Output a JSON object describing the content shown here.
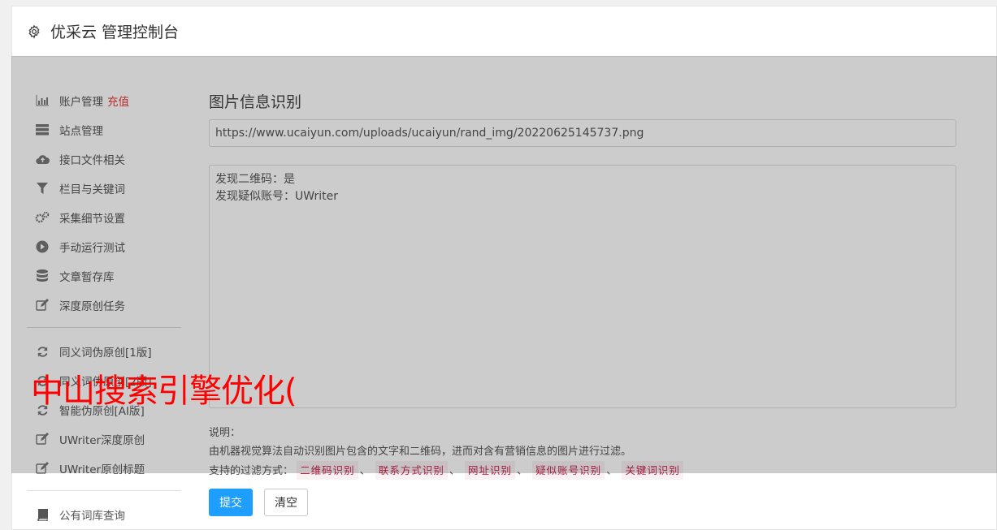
{
  "header": {
    "title": "优采云 管理控制台",
    "icon": "gear-icon"
  },
  "sidebar": {
    "items": [
      {
        "label": "账户管理",
        "badge": "充值",
        "icon": "bar-chart-icon"
      },
      {
        "label": "站点管理",
        "icon": "server-icon"
      },
      {
        "label": "接口文件相关",
        "icon": "cloud-upload-icon"
      },
      {
        "label": "栏目与关键词",
        "icon": "filter-icon"
      },
      {
        "label": "采集细节设置",
        "icon": "gears-icon"
      },
      {
        "label": "手动运行测试",
        "icon": "play-circle-icon"
      },
      {
        "label": "文章暂存库",
        "icon": "database-icon"
      },
      {
        "label": "深度原创任务",
        "icon": "edit-icon"
      },
      {
        "label": "同义词伪原创[1版]",
        "icon": "refresh-icon"
      },
      {
        "label": "同义词伪原创[2版]",
        "icon": "refresh-icon"
      },
      {
        "label": "智能伪原创[AI版]",
        "icon": "refresh-icon"
      },
      {
        "label": "UWriter深度原创",
        "icon": "edit-icon"
      },
      {
        "label": "UWriter原创标题",
        "icon": "edit-icon"
      },
      {
        "label": "公有词库查询",
        "icon": "book-icon"
      }
    ]
  },
  "main": {
    "title": "图片信息识别",
    "url_value": "https://www.ucaiyun.com/uploads/ucaiyun/rand_img/20220625145737.png",
    "result_lines": [
      "发现二维码：是",
      "发现疑似账号：UWriter"
    ],
    "desc_heading": "说明：",
    "desc_text": "由机器视觉算法自动识别图片包含的文字和二维码，进而对含有营销信息的图片进行过滤。",
    "filter_prefix": "支持的过滤方式：",
    "filters": [
      "二维码识别",
      "联系方式识别",
      "网址识别",
      "疑似账号识别",
      "关键词识别"
    ],
    "filter_sep": "、"
  },
  "buttons": {
    "submit": "提交",
    "clear": "清空"
  },
  "watermark": "中山搜索引擎优化(",
  "colors": {
    "primary": "#1e9fff",
    "badge": "#e53935",
    "tag": "#c7254e",
    "watermark": "#ff0000"
  }
}
